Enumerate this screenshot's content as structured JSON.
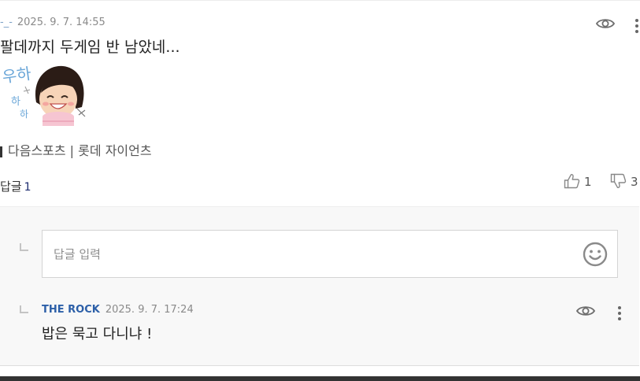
{
  "comment": {
    "nickname": "-_-",
    "timestamp": "2025. 9. 7. 14:55",
    "text": "팔데까지 두게임 반 남았네...",
    "tag": "다음스포츠 | 롯데 자이언츠",
    "reply_label": "답글",
    "reply_count": "1",
    "like_count": "1",
    "dislike_count": "3"
  },
  "sticker": {
    "caption_lines": [
      "우하",
      "하",
      "하"
    ]
  },
  "reply_input": {
    "placeholder": "답글 입력"
  },
  "reply": {
    "nickname": "THE ROCK",
    "timestamp": "2025. 9. 7. 17:24",
    "text": "밥은 묵고 다니냐 !"
  },
  "icons": {
    "view": "eye-icon",
    "more": "more-vertical-icon",
    "like": "thumbs-up-icon",
    "dislike": "thumbs-down-icon",
    "emoji": "smiley-icon",
    "reply_marker": "reply-corner-icon"
  },
  "colors": {
    "reply_nickname": "#2c5fa8",
    "comment_nickname": "#7fa3c8",
    "reply_count": "#1d2b6f",
    "reply_area_bg": "#f8f8f8"
  }
}
